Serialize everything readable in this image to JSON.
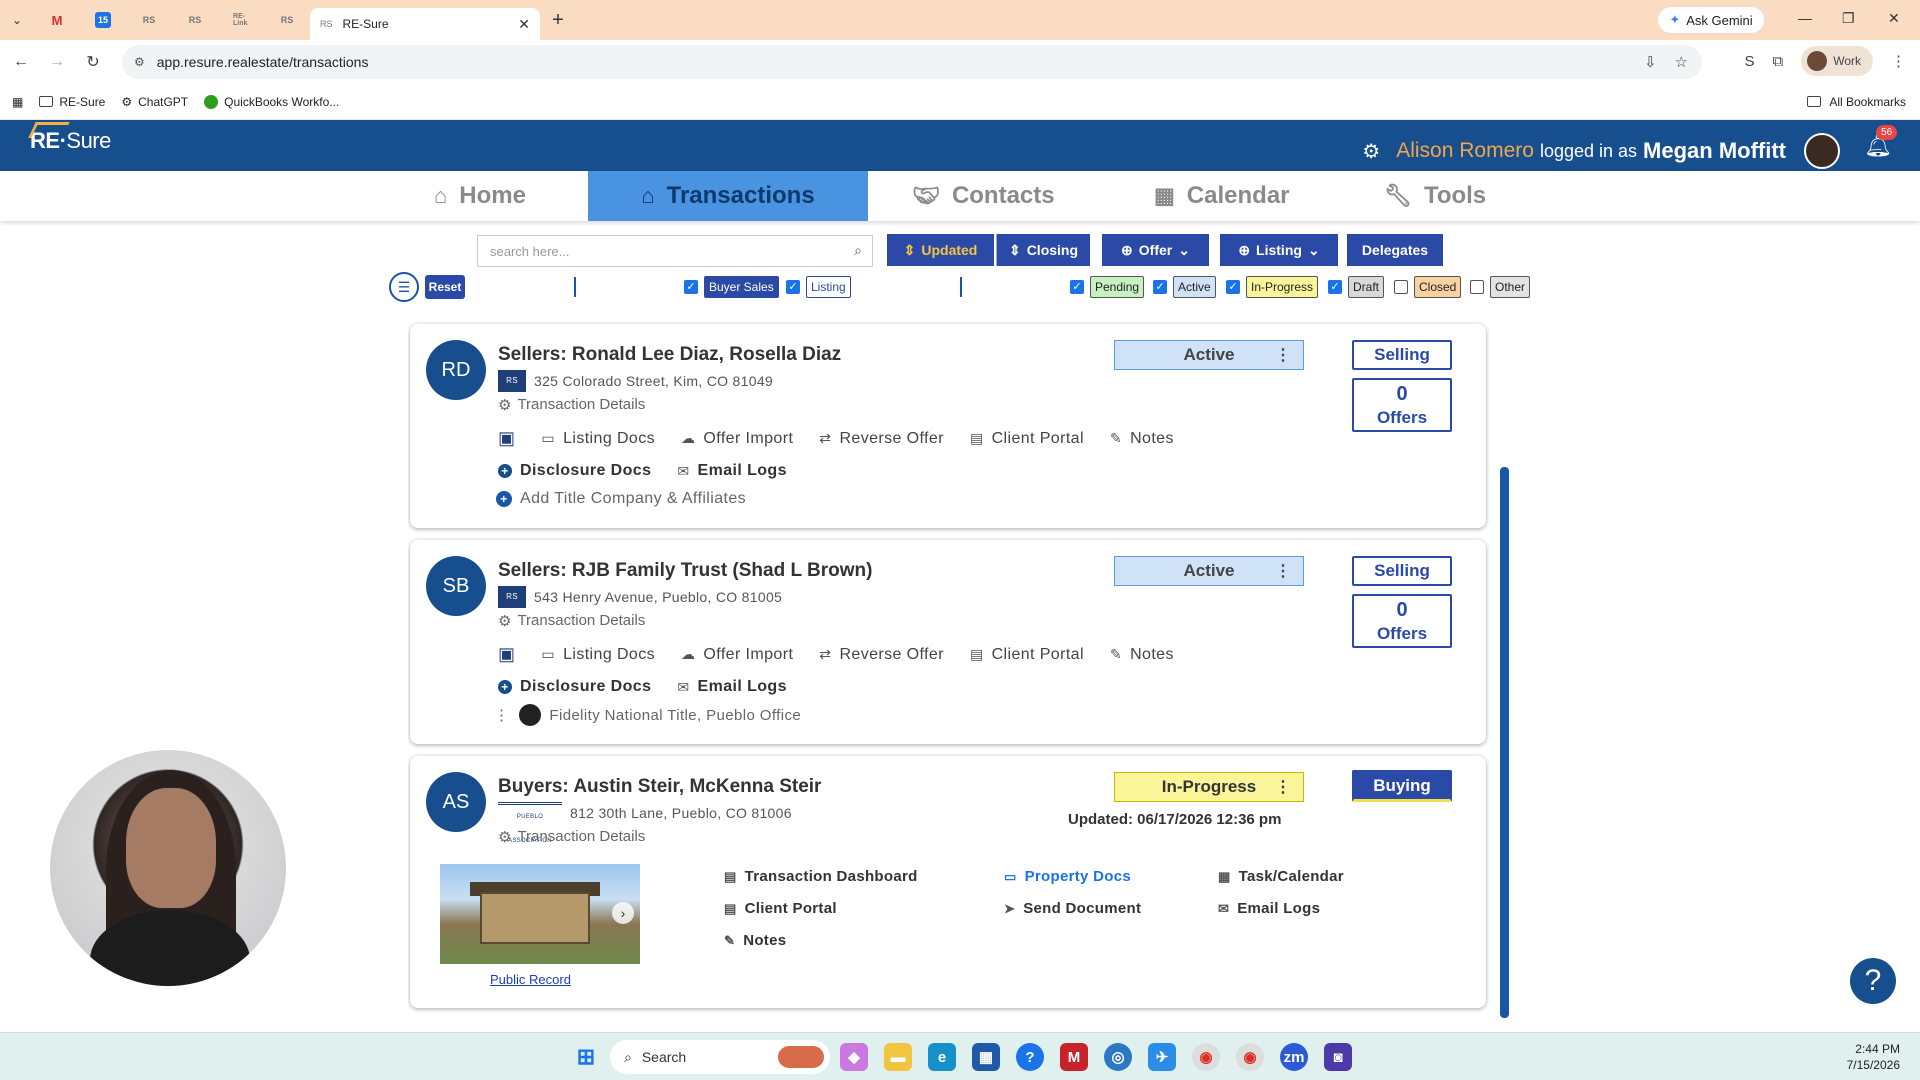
{
  "browser": {
    "active_tab_title": "RE-Sure",
    "active_tab_favicon": "RS",
    "mini_tabs": [
      "",
      "",
      "15",
      "RS",
      "RS",
      "RE-Link",
      "RS"
    ],
    "ask_gemini": "Ask Gemini",
    "url": "app.resure.realestate/transactions",
    "profile": "Work",
    "bookmarks": [
      {
        "label": "RE-Sure",
        "icon": "folder-icon"
      },
      {
        "label": "ChatGPT",
        "icon": "chatgpt-icon"
      },
      {
        "label": "QuickBooks Workfo...",
        "icon": "quickbooks-icon"
      }
    ],
    "all_bookmarks": "All Bookmarks"
  },
  "app": {
    "logo_re": "RE",
    "logo_sure": "Sure",
    "admin_name": "Alison Romero",
    "logged_in_as": "logged in as",
    "user_name": "Megan Moffitt",
    "notifications": "56"
  },
  "nav": {
    "tabs": [
      {
        "label": "Home",
        "icon": "home-icon"
      },
      {
        "label": "Transactions",
        "icon": "transactions-icon",
        "selected": true
      },
      {
        "label": "Contacts",
        "icon": "handshake-icon"
      },
      {
        "label": "Calendar",
        "icon": "calendar-icon"
      },
      {
        "label": "Tools",
        "icon": "wrench-icon"
      }
    ]
  },
  "toolbar": {
    "search_placeholder": "search here...",
    "updated": "Updated",
    "closing": "Closing",
    "offer": "Offer",
    "listing": "Listing",
    "delegates": "Delegates"
  },
  "filters": {
    "reset": "Reset",
    "buyer_sales": "Buyer Sales",
    "listing": "Listing",
    "statuses": [
      {
        "label": "Pending",
        "checked": true,
        "color": "#c9f0c3"
      },
      {
        "label": "Active",
        "checked": true,
        "color": "#cfe2f7"
      },
      {
        "label": "In-Progress",
        "checked": true,
        "color": "#fbf59a"
      },
      {
        "label": "Draft",
        "checked": true,
        "color": "#d9d9d9"
      },
      {
        "label": "Closed",
        "checked": false,
        "color": "#f9d2a2"
      },
      {
        "label": "Other",
        "checked": false,
        "color": "#e3e3e3"
      }
    ]
  },
  "transactions": [
    {
      "initials": "RD",
      "title": "Sellers: Ronald Lee Diaz, Rosella Diaz",
      "address": "325 Colorado Street, Kim, CO 81049",
      "details": "Transaction Details",
      "status": "Active",
      "side": "Selling",
      "offers_count": "0",
      "offers_label": "Offers",
      "actions": [
        "Listing Docs",
        "Offer Import",
        "Reverse Offer",
        "Client Portal",
        "Notes"
      ],
      "disclosure": "Disclosure Docs",
      "email_logs": "Email Logs",
      "title_company": "Add Title Company & Affiliates"
    },
    {
      "initials": "SB",
      "title": "Sellers: RJB Family Trust (Shad L Brown)",
      "address": "543 Henry Avenue, Pueblo, CO 81005",
      "details": "Transaction Details",
      "status": "Active",
      "side": "Selling",
      "offers_count": "0",
      "offers_label": "Offers",
      "actions": [
        "Listing Docs",
        "Offer Import",
        "Reverse Offer",
        "Client Portal",
        "Notes"
      ],
      "disclosure": "Disclosure Docs",
      "email_logs": "Email Logs",
      "title_company": "Fidelity National Title, Pueblo Office"
    },
    {
      "initials": "AS",
      "title": "Buyers: Austin Steir, McKenna Steir",
      "address": "812 30th Lane, Pueblo, CO 81006",
      "details": "Transaction Details",
      "status": "In-Progress",
      "side": "Buying",
      "updated": "Updated: 06/17/2026 12:36 pm",
      "public_record": "Public Record",
      "links": [
        "Transaction Dashboard",
        "Property Docs",
        "Task/Calendar",
        "Client Portal",
        "Send Document",
        "Email Logs",
        "Notes"
      ]
    }
  ],
  "taskbar": {
    "search": "Search",
    "time": "2:44 PM",
    "date": "7/15/2026"
  }
}
